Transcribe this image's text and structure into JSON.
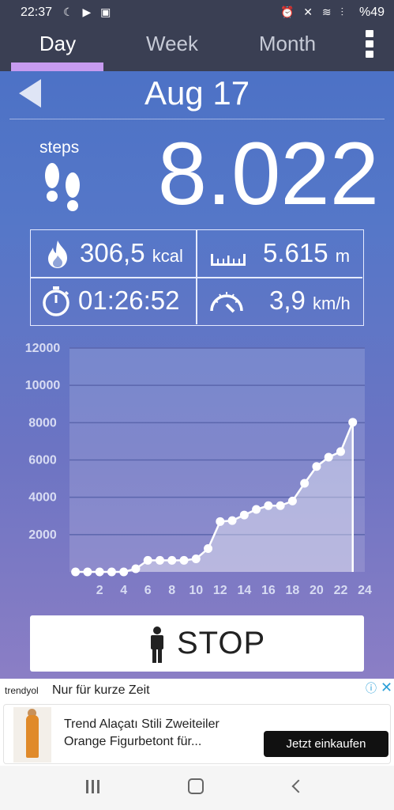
{
  "status_bar": {
    "time": "22:37",
    "left_icons": "☾ ▶ ▣",
    "right_icons": "⏰ ✕ ≋ ⫶",
    "battery": "%49"
  },
  "tabs": [
    {
      "label": "Day",
      "active": true
    },
    {
      "label": "Week",
      "active": false
    },
    {
      "label": "Month",
      "active": false
    }
  ],
  "date": "Aug 17",
  "steps": {
    "label": "steps",
    "value": "8.022"
  },
  "stats": {
    "calories": {
      "value": "306,5",
      "unit": "kcal"
    },
    "distance": {
      "value": "5.615",
      "unit": "m"
    },
    "duration": {
      "value": "01:26:52"
    },
    "speed": {
      "value": "3,9",
      "unit": "km/h"
    }
  },
  "chart_data": {
    "type": "area",
    "x": [
      0,
      1,
      2,
      3,
      4,
      5,
      6,
      7,
      8,
      9,
      10,
      11,
      12,
      13,
      14,
      15,
      16,
      17,
      18,
      19,
      20,
      21,
      22,
      23
    ],
    "y": [
      0,
      0,
      0,
      0,
      0,
      170,
      620,
      620,
      620,
      620,
      700,
      1250,
      2700,
      2750,
      3050,
      3350,
      3550,
      3550,
      3800,
      4750,
      5650,
      6150,
      6450,
      8022
    ],
    "y_ticks": [
      "2000",
      "4000",
      "6000",
      "8000",
      "10000",
      "12000"
    ],
    "x_ticks": [
      "2",
      "4",
      "6",
      "8",
      "10",
      "12",
      "14",
      "16",
      "18",
      "20",
      "22",
      "24"
    ],
    "ylim": [
      0,
      12000
    ],
    "xlim": [
      -0.5,
      24
    ],
    "grid": true
  },
  "stop_button": {
    "label": "STOP"
  },
  "ad": {
    "brand": "trendyol",
    "headline": "Nur für kurze Zeit",
    "text": "Trend Alaçatı Stili Zweiteiler Orange Figurbetont für...",
    "cta": "Jetzt einkaufen"
  },
  "colors": {
    "accent": "#c79bf0",
    "tabbar": "#3a3f53"
  }
}
